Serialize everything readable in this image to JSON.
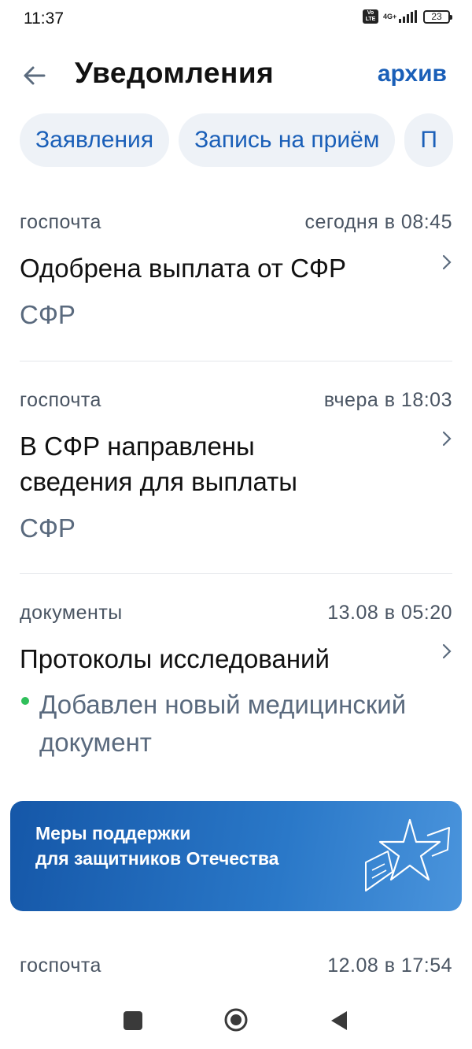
{
  "status_bar": {
    "time": "11:37",
    "volte": "Vo LTE",
    "network": "4G+",
    "battery": "23"
  },
  "header": {
    "title": "Уведомления",
    "archive_label": "архив"
  },
  "chips": [
    {
      "label": "Заявления"
    },
    {
      "label": "Запись на приём"
    },
    {
      "label": "П"
    }
  ],
  "notifications": [
    {
      "category": "госпочта",
      "time": "сегодня в 08:45",
      "title": "Одобрена выплата от СФР",
      "source": "СФР"
    },
    {
      "category": "госпочта",
      "time": "вчера в 18:03",
      "title": "В СФР направлены сведения для выплаты",
      "source": "СФР"
    },
    {
      "category": "документы",
      "time": "13.08 в 05:20",
      "title": "Протоколы исследований",
      "description": "Добавлен новый медицинский документ",
      "unread": true
    },
    {
      "category": "госпочта",
      "time": "12.08 в 17:54"
    }
  ],
  "banner": {
    "line1": "Меры поддержки",
    "line2": "для защитников Отечества"
  },
  "colors": {
    "accent": "#1a5fb8",
    "unread_dot": "#2fbf5a",
    "banner_start": "#1557a8",
    "banner_end": "#4a94dc"
  }
}
